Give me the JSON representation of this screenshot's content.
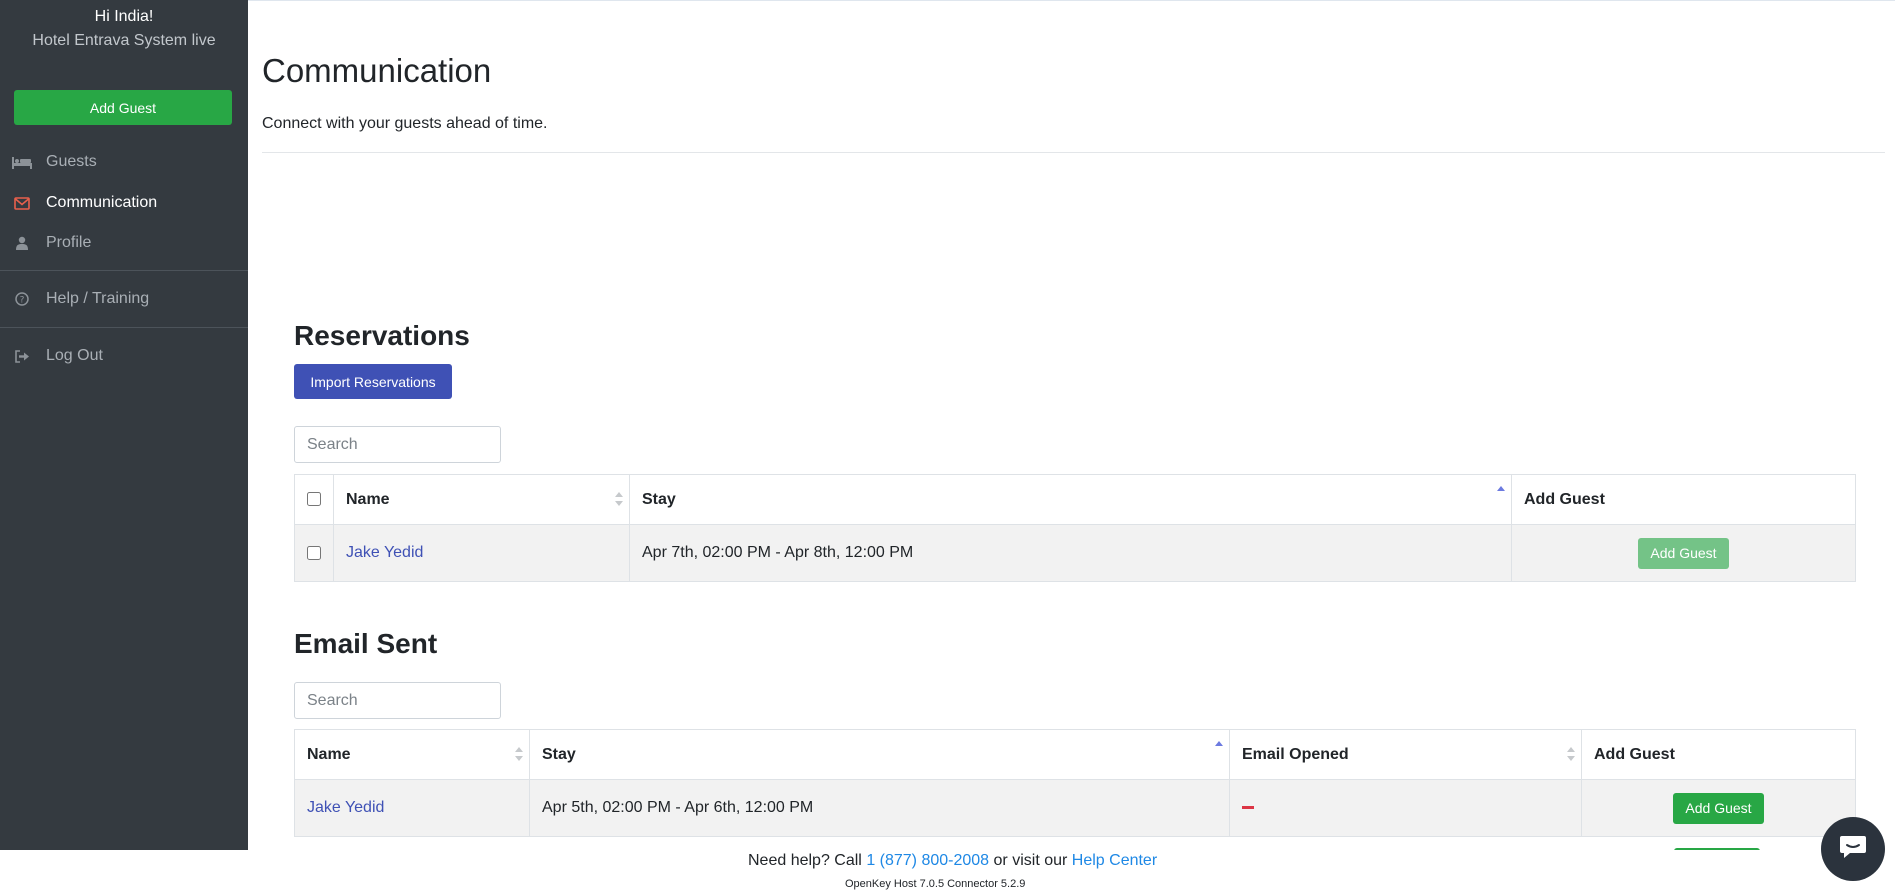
{
  "sidebar": {
    "greeting": "Hi India!",
    "hotel": "Hotel Entrava System live",
    "add_guest_label": "Add Guest",
    "items": [
      {
        "label": "Guests",
        "icon": "bed-icon"
      },
      {
        "label": "Communication",
        "icon": "envelope-icon",
        "active": true
      },
      {
        "label": "Profile",
        "icon": "user-icon"
      },
      {
        "label": "Help / Training",
        "icon": "question-circle-icon"
      },
      {
        "label": "Log Out",
        "icon": "sign-out-icon"
      }
    ]
  },
  "page": {
    "title": "Communication",
    "subtitle": "Connect with your guests ahead of time."
  },
  "reservations": {
    "title": "Reservations",
    "import_label": "Import Reservations",
    "search_placeholder": "Search",
    "columns": [
      "Name",
      "Stay",
      "Add Guest"
    ],
    "rows": [
      {
        "name": "Jake Yedid",
        "stay": "Apr 7th, 02:00 PM - Apr 8th, 12:00 PM",
        "action": "Add Guest"
      }
    ]
  },
  "email_sent": {
    "title": "Email Sent",
    "search_placeholder": "Search",
    "columns": [
      "Name",
      "Stay",
      "Email Opened",
      "Add Guest"
    ],
    "rows": [
      {
        "name": "Jake Yedid",
        "stay": "Apr 5th, 02:00 PM - Apr 6th, 12:00 PM",
        "action": "Add Guest"
      }
    ]
  },
  "footer": {
    "help_prefix": "Need help? Call",
    "phone": "1 (877) 800-2008",
    "help_mid": "or visit our",
    "help_center": "Help Center",
    "version": "OpenKey Host 7.0.5   Connector 5.2.9"
  },
  "colors": {
    "sidebar_bg": "#343a40",
    "success": "#28a745",
    "primary": "#3f51b5",
    "link": "#1e88e5",
    "danger": "#dc3545",
    "active_icon": "#e8604c"
  }
}
